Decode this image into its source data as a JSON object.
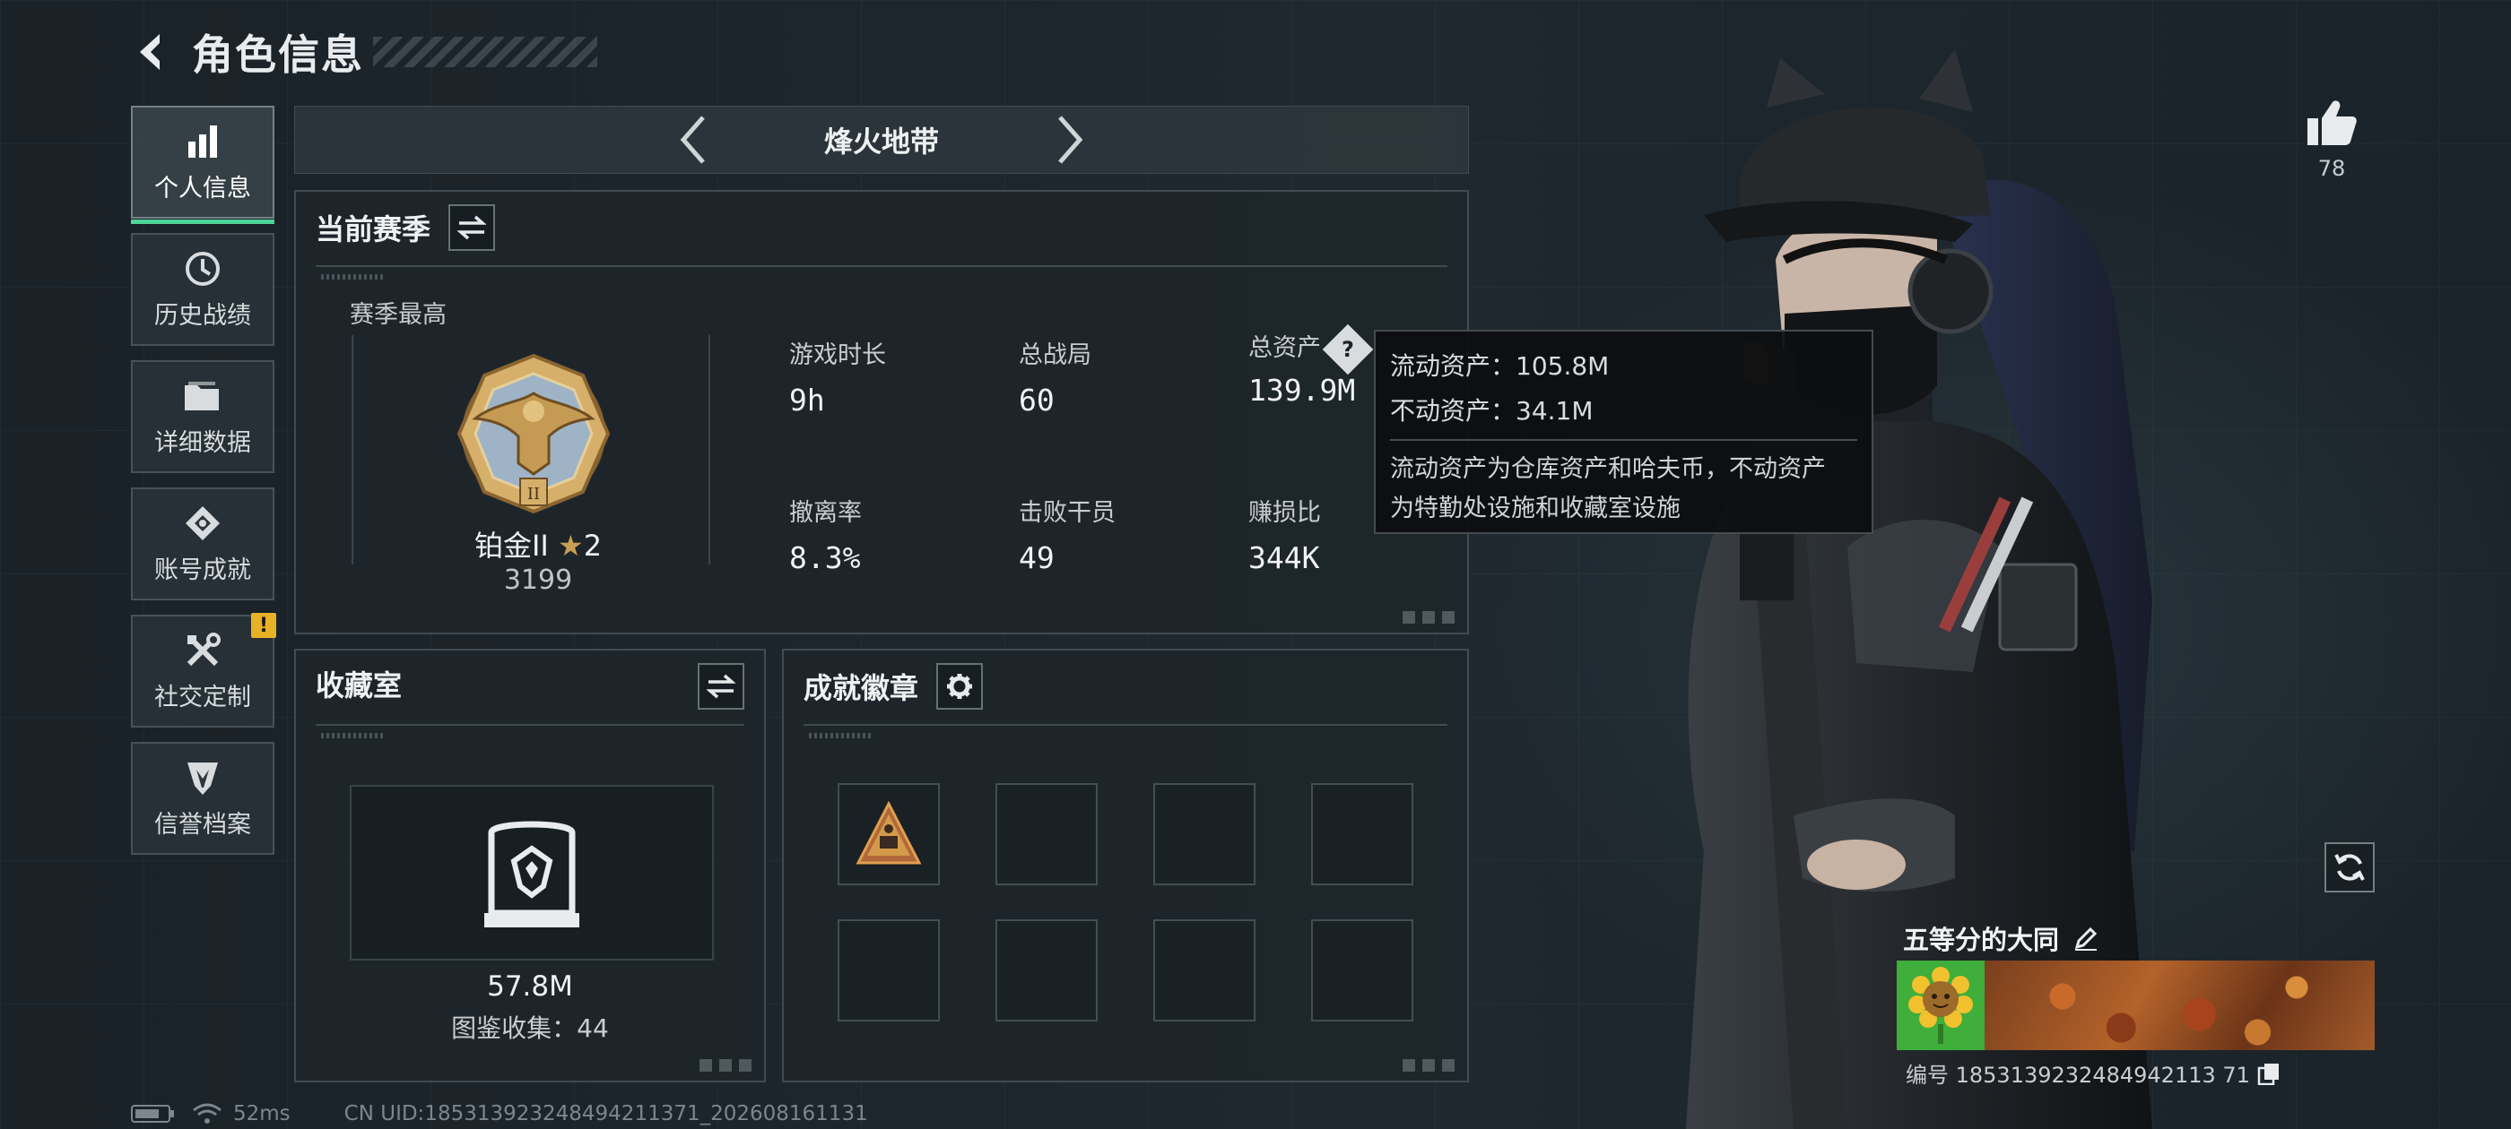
{
  "header": {
    "title": "角色信息"
  },
  "sidebar": {
    "items": [
      {
        "label": "个人信息",
        "icon": "bar-chart-icon",
        "active": true
      },
      {
        "label": "历史战绩",
        "icon": "history-icon"
      },
      {
        "label": "详细数据",
        "icon": "folder-icon"
      },
      {
        "label": "账号成就",
        "icon": "achievement-icon"
      },
      {
        "label": "社交定制",
        "icon": "tools-icon",
        "alert": "!"
      },
      {
        "label": "信誉档案",
        "icon": "shield-icon"
      }
    ]
  },
  "mode": {
    "name": "烽火地带"
  },
  "season": {
    "title": "当前赛季",
    "subtitle": "赛季最高",
    "rank_name": "铂金II",
    "rank_stars": "2",
    "rank_score": "3199",
    "stats": [
      {
        "label": "游戏时长",
        "value": "9h"
      },
      {
        "label": "总战局",
        "value": "60"
      },
      {
        "label": "总资产",
        "value": "139.9M"
      },
      {
        "label": "撤离率",
        "value": "8.3%"
      },
      {
        "label": "击败干员",
        "value": "49"
      },
      {
        "label": "赚损比",
        "value": "344K"
      }
    ],
    "help_glyph": "?"
  },
  "tooltip": {
    "liquid": "流动资产：105.8M",
    "fixed": "不动资产：34.1M",
    "desc_1": "流动资产为仓库资产和哈夫币，不动资产",
    "desc_2": "为特勤处设施和收藏室设施"
  },
  "collection": {
    "title": "收藏室",
    "value": "57.8M",
    "count": "图鉴收集：44"
  },
  "badges": {
    "title": "成就徽章"
  },
  "profile": {
    "likes": "78",
    "name": "五等分的大同",
    "id": "编号 1853139232484942113 71"
  },
  "status": {
    "latency": "52ms",
    "uid": "CN UID:185313923248494211371_202608161131"
  },
  "colors": {
    "accent": "#4fd39b",
    "alert": "#e8b226",
    "gold": "#c9a052"
  }
}
